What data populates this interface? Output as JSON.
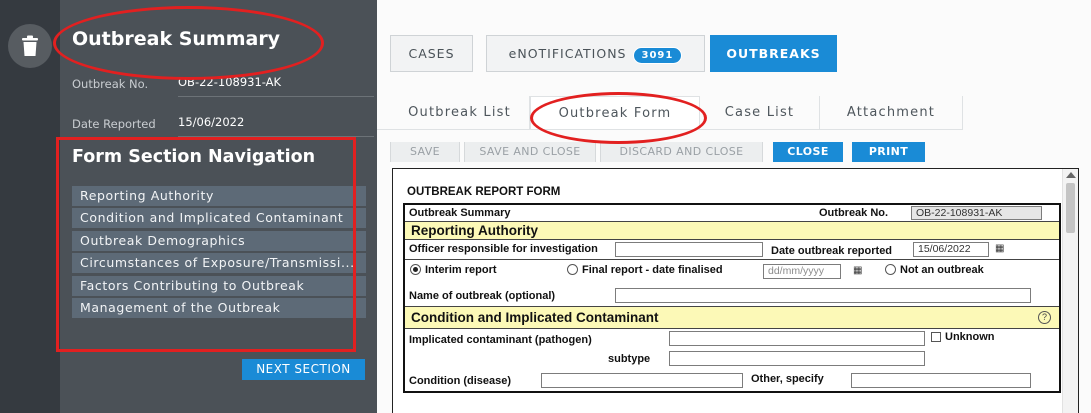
{
  "summary": {
    "title": "Outbreak Summary",
    "outbreak_no_label": "Outbreak No.",
    "outbreak_no_value": "OB-22-108931-AK",
    "date_reported_label": "Date Reported",
    "date_reported_value": "15/06/2022"
  },
  "navigation": {
    "title": "Form Section Navigation",
    "items": [
      "Reporting Authority",
      "Condition and Implicated Contaminant",
      "Outbreak Demographics",
      "Circumstances of Exposure/Transmissi...",
      "Factors Contributing to Outbreak",
      "Management of the Outbreak"
    ],
    "next_button": "NEXT SECTION"
  },
  "top_tabs": {
    "cases": "CASES",
    "enotifications": "eNOTIFICATIONS",
    "enotifications_count": "3091",
    "outbreaks": "OUTBREAKS"
  },
  "sub_tabs": [
    "Outbreak List",
    "Outbreak Form",
    "Case List",
    "Attachment"
  ],
  "actions": {
    "save": "SAVE",
    "save_close": "SAVE AND CLOSE",
    "discard_close": "DISCARD AND CLOSE",
    "close": "CLOSE",
    "print": "PRINT"
  },
  "form": {
    "title": "OUTBREAK REPORT FORM",
    "summary_label": "Outbreak Summary",
    "outbreak_no_label": "Outbreak No.",
    "outbreak_no_value": "OB-22-108931-AK",
    "reporting_authority": {
      "heading": "Reporting Authority",
      "officer_label": "Officer responsible for investigation",
      "date_label": "Date outbreak reported",
      "date_value": "15/06/2022",
      "interim_label": "Interim report",
      "final_label": "Final report  -  date finalised",
      "final_placeholder": "dd/mm/yyyy",
      "not_outbreak_label": "Not an outbreak",
      "name_label": "Name of outbreak (optional)"
    },
    "condition": {
      "heading": "Condition and Implicated Contaminant",
      "contaminant_label": "Implicated contaminant (pathogen)",
      "unknown_label": "Unknown",
      "subtype_label": "subtype",
      "disease_label": "Condition (disease)",
      "other_label": "Other, specify"
    }
  },
  "colors": {
    "accent": "#1a8bd6",
    "panel": "#4b5157",
    "rail": "#353a40",
    "nav_item": "#5d6a77",
    "section_yellow": "#fcf9b7",
    "annotation_red": "#e22020"
  },
  "icons": {
    "trash": "trash-icon",
    "help": "help-icon",
    "calendar": "calendar-icon"
  }
}
